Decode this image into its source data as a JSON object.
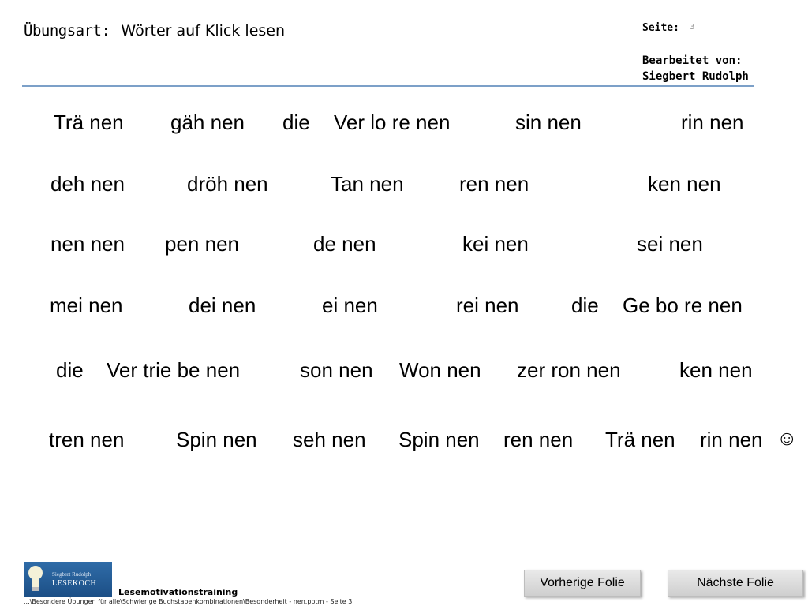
{
  "header": {
    "exercise_label": "Übungsart:",
    "exercise_name": "Wörter auf Klick lesen",
    "page_label": "Seite:",
    "page_number": "3",
    "edited_by_label": "Bearbeitet von:",
    "author": "Siegbert Rudolph"
  },
  "words": [
    [
      "Trä nen",
      "gäh nen",
      "die",
      "Ver lo re nen",
      "sin nen",
      "rin nen"
    ],
    [
      "deh nen",
      "dröh nen",
      "Tan nen",
      "ren nen",
      "ken nen"
    ],
    [
      "nen nen",
      "pen nen",
      "de nen",
      "kei nen",
      "sei nen"
    ],
    [
      "mei nen",
      "dei nen",
      "ei nen",
      "rei nen",
      "die",
      "Ge bo re nen"
    ],
    [
      "die",
      "Ver trie be nen",
      "son nen",
      "Won nen",
      "zer ron nen",
      "ken nen"
    ],
    [
      "tren nen",
      "Spin nen",
      "seh nen",
      "Spin nen",
      "ren nen",
      "Trä nen",
      "rin nen"
    ]
  ],
  "smiley": "☺",
  "footer": {
    "logo_name": "Siegbert Rudolph",
    "logo_brand": "LESEKOCH",
    "title": "Lesemotivationstraining",
    "path": "...\\Besondere Übungen für alle\\Schwierige Buchstabenkombinationen\\Besonderheit - nen.pptm - Seite 3",
    "prev_button": "Vorherige Folie",
    "next_button": "Nächste Folie"
  }
}
